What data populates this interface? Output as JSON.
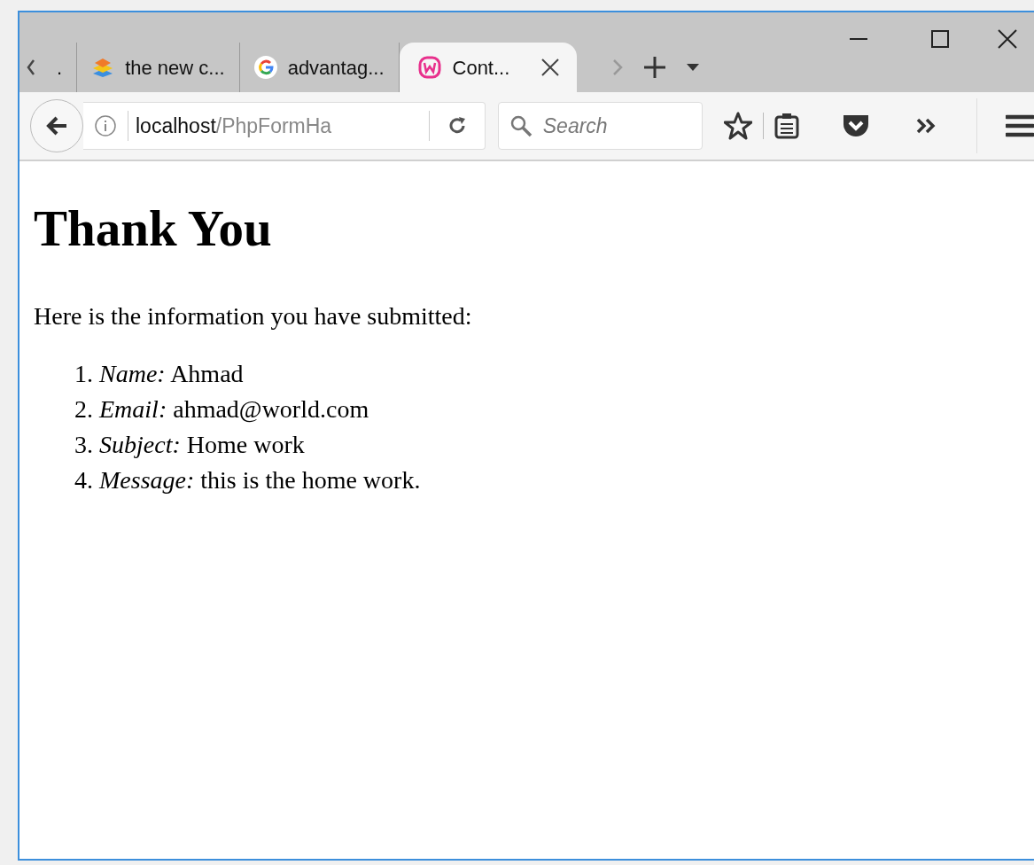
{
  "tabs": [
    {
      "label": ".",
      "kind": "plain",
      "selected": false
    },
    {
      "label": "the new c...",
      "kind": "layers",
      "selected": false
    },
    {
      "label": "advantag...",
      "kind": "google",
      "selected": false
    },
    {
      "label": "Cont...",
      "kind": "wamp",
      "selected": true
    }
  ],
  "address": {
    "host": "localhost",
    "path": "/PhpFormHa"
  },
  "search": {
    "placeholder": "Search"
  },
  "page": {
    "heading": "Thank You",
    "intro": "Here is the information you have submitted:",
    "items": [
      {
        "number": "1.",
        "label": "Name:",
        "value": "Ahmad"
      },
      {
        "number": "2.",
        "label": "Email:",
        "value": "ahmad@world.com"
      },
      {
        "number": "3.",
        "label": "Subject:",
        "value": "Home work"
      },
      {
        "number": "4.",
        "label": "Message:",
        "value": "this is the home work."
      }
    ]
  }
}
